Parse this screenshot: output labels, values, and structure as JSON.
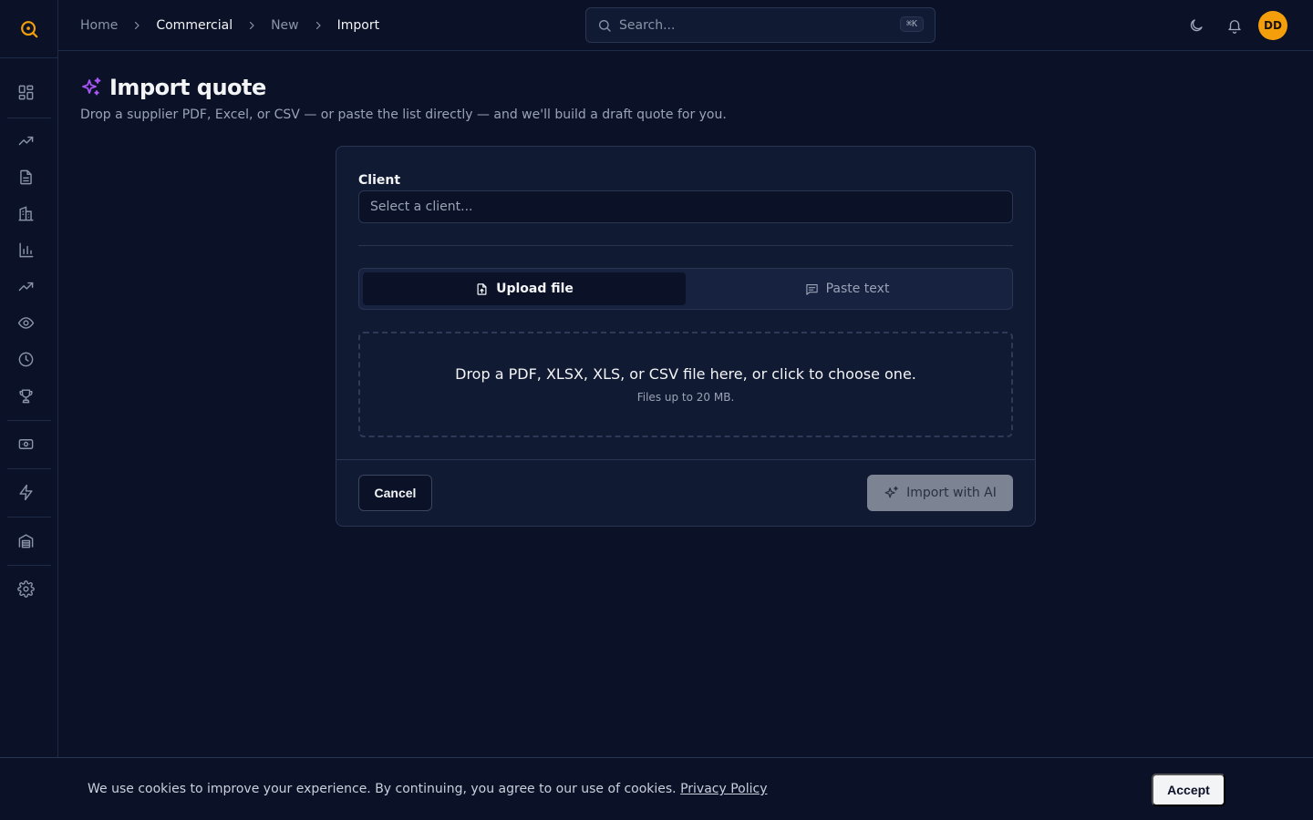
{
  "sidebar": {
    "logo_icon": "search-logo-icon",
    "items": [
      {
        "name": "dashboard-icon"
      },
      {
        "name": "trending-up-icon"
      },
      {
        "name": "document-icon"
      },
      {
        "name": "building-icon"
      },
      {
        "name": "bar-chart-icon"
      },
      {
        "name": "trend-icon"
      },
      {
        "name": "eye-icon"
      },
      {
        "name": "clock-icon"
      },
      {
        "name": "trophy-icon"
      },
      {
        "name": "banknote-icon"
      },
      {
        "name": "zap-icon"
      },
      {
        "name": "warehouse-icon"
      },
      {
        "name": "gear-icon"
      }
    ]
  },
  "breadcrumb": {
    "items": [
      "Home",
      "Commercial",
      "New",
      "Import"
    ]
  },
  "search": {
    "placeholder": "Search...",
    "shortcut": "⌘K"
  },
  "header_icons": [
    "moon-icon",
    "bell-icon"
  ],
  "user": {
    "initials": "DD",
    "avatar_color": "#f59e0b"
  },
  "page": {
    "title": "Import quote",
    "subtitle": "Drop a supplier PDF, Excel, or CSV — or paste the list directly — and we'll build a draft quote for you."
  },
  "form": {
    "client_label": "Client",
    "client_placeholder": "Select a client...",
    "tabs": [
      {
        "label": "Upload file",
        "active": true
      },
      {
        "label": "Paste text",
        "active": false
      }
    ],
    "dropzone_main": "Drop a PDF, XLSX, XLS, or CSV file here, or click to choose one.",
    "dropzone_sub": "Files up to 20 MB.",
    "cancel_label": "Cancel",
    "import_label": "Import with AI"
  },
  "cookie": {
    "text": "We use cookies to improve your experience. By continuing, you agree to our use of cookies.",
    "link": "Privacy Policy",
    "accept_label": "Accept"
  },
  "colors": {
    "accent": "#f59e0b",
    "sparkle": "#a855f7",
    "background": "#0b1228"
  }
}
